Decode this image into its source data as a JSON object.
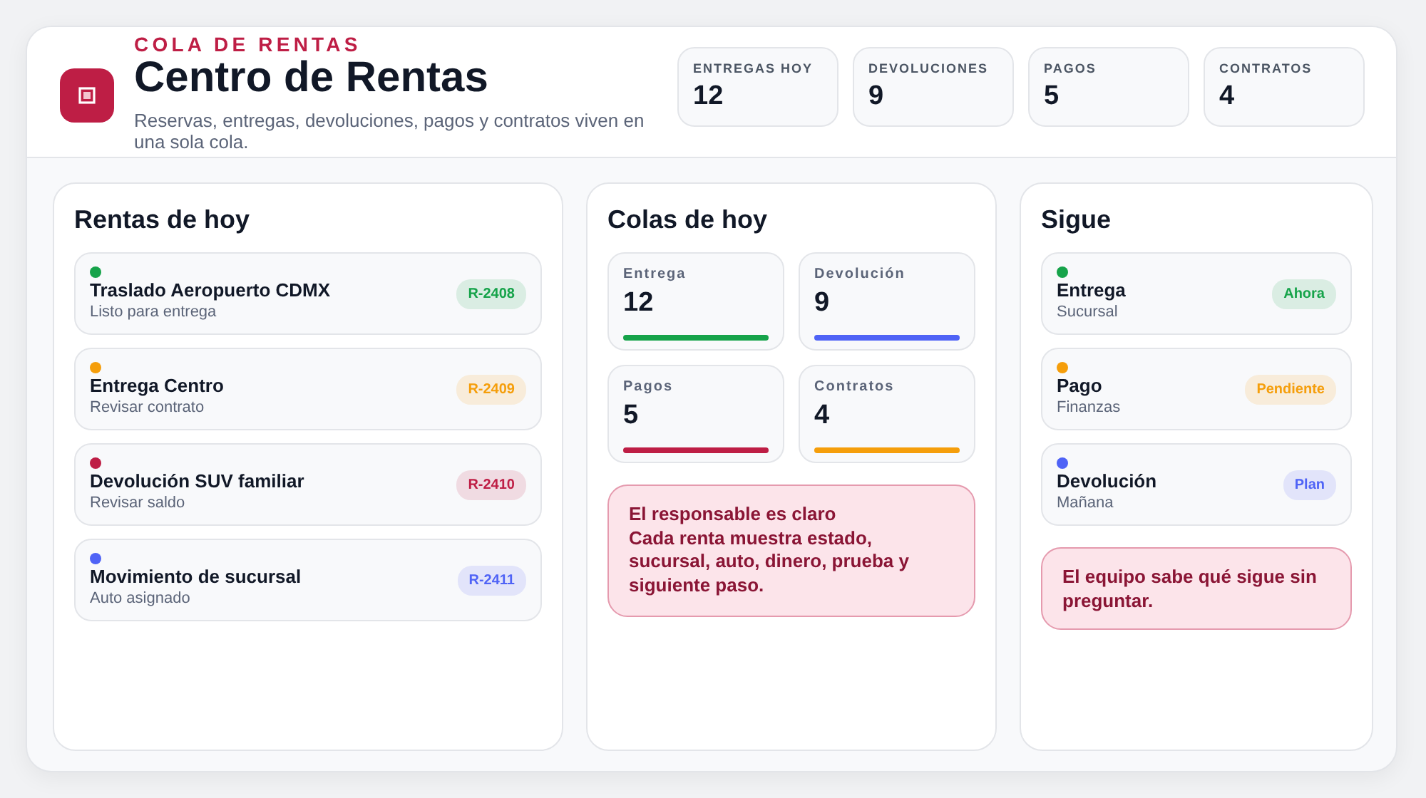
{
  "header": {
    "eyebrow": "COLA DE RENTAS",
    "title": "Centro de Rentas",
    "subtitle": "Reservas, entregas, devoluciones, pagos y contratos viven en una sola cola."
  },
  "stats": [
    {
      "label": "ENTREGAS HOY",
      "value": "12"
    },
    {
      "label": "DEVOLUCIONES",
      "value": "9"
    },
    {
      "label": "PAGOS",
      "value": "5"
    },
    {
      "label": "CONTRATOS",
      "value": "4"
    }
  ],
  "rentals": {
    "title": "Rentas de hoy",
    "items": [
      {
        "title": "Traslado Aeropuerto CDMX",
        "subtitle": "Listo para entrega",
        "badge": "R-2408",
        "color": "#16a34a"
      },
      {
        "title": "Entrega Centro",
        "subtitle": "Revisar contrato",
        "badge": "R-2409",
        "color": "#f59e0b"
      },
      {
        "title": "Devolución SUV familiar",
        "subtitle": "Revisar saldo",
        "badge": "R-2410",
        "color": "#be1e45"
      },
      {
        "title": "Movimiento de sucursal",
        "subtitle": "Auto asignado",
        "badge": "R-2411",
        "color": "#4f63f6"
      }
    ]
  },
  "queues": {
    "title": "Colas de hoy",
    "tiles": [
      {
        "label": "Entrega",
        "value": "12",
        "color": "#16a34a"
      },
      {
        "label": "Devolución",
        "value": "9",
        "color": "#4f63f6"
      },
      {
        "label": "Pagos",
        "value": "5",
        "color": "#be1e45"
      },
      {
        "label": "Contratos",
        "value": "4",
        "color": "#f59e0b"
      }
    ],
    "note": {
      "title": "El responsable es claro",
      "text": "Cada renta muestra estado, sucursal, auto, dinero, prueba y siguiente paso."
    }
  },
  "next": {
    "title": "Sigue",
    "items": [
      {
        "title": "Entrega",
        "subtitle": "Sucursal",
        "badge": "Ahora",
        "color": "#16a34a"
      },
      {
        "title": "Pago",
        "subtitle": "Finanzas",
        "badge": "Pendiente",
        "color": "#f59e0b"
      },
      {
        "title": "Devolución",
        "subtitle": "Mañana",
        "badge": "Plan",
        "color": "#4f63f6"
      }
    ],
    "note": {
      "text": "El equipo sabe qué sigue sin preguntar."
    }
  }
}
